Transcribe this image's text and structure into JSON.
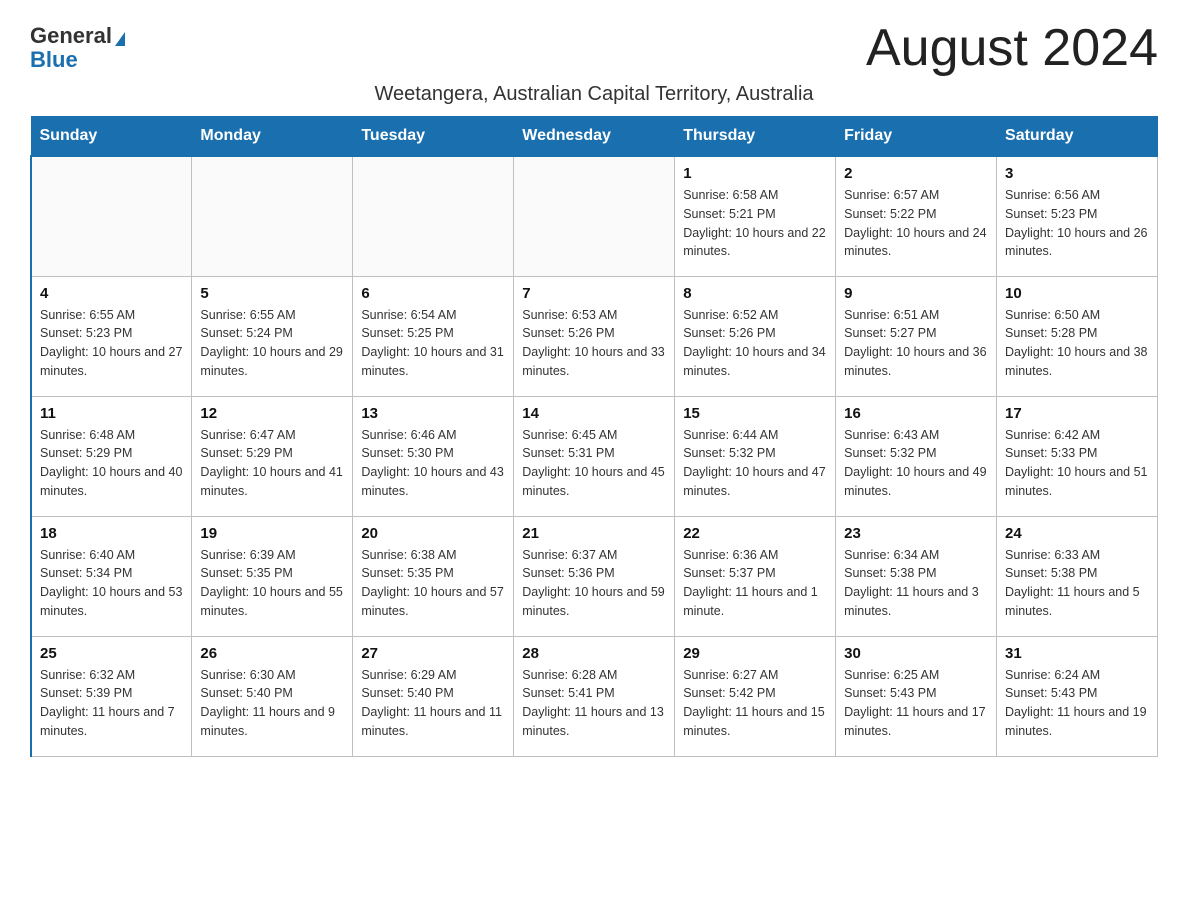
{
  "header": {
    "logo_general": "General",
    "logo_blue": "Blue",
    "month_title": "August 2024",
    "location": "Weetangera, Australian Capital Territory, Australia"
  },
  "columns": [
    "Sunday",
    "Monday",
    "Tuesday",
    "Wednesday",
    "Thursday",
    "Friday",
    "Saturday"
  ],
  "weeks": [
    [
      {
        "day": "",
        "sunrise": "",
        "sunset": "",
        "daylight": ""
      },
      {
        "day": "",
        "sunrise": "",
        "sunset": "",
        "daylight": ""
      },
      {
        "day": "",
        "sunrise": "",
        "sunset": "",
        "daylight": ""
      },
      {
        "day": "",
        "sunrise": "",
        "sunset": "",
        "daylight": ""
      },
      {
        "day": "1",
        "sunrise": "Sunrise: 6:58 AM",
        "sunset": "Sunset: 5:21 PM",
        "daylight": "Daylight: 10 hours and 22 minutes."
      },
      {
        "day": "2",
        "sunrise": "Sunrise: 6:57 AM",
        "sunset": "Sunset: 5:22 PM",
        "daylight": "Daylight: 10 hours and 24 minutes."
      },
      {
        "day": "3",
        "sunrise": "Sunrise: 6:56 AM",
        "sunset": "Sunset: 5:23 PM",
        "daylight": "Daylight: 10 hours and 26 minutes."
      }
    ],
    [
      {
        "day": "4",
        "sunrise": "Sunrise: 6:55 AM",
        "sunset": "Sunset: 5:23 PM",
        "daylight": "Daylight: 10 hours and 27 minutes."
      },
      {
        "day": "5",
        "sunrise": "Sunrise: 6:55 AM",
        "sunset": "Sunset: 5:24 PM",
        "daylight": "Daylight: 10 hours and 29 minutes."
      },
      {
        "day": "6",
        "sunrise": "Sunrise: 6:54 AM",
        "sunset": "Sunset: 5:25 PM",
        "daylight": "Daylight: 10 hours and 31 minutes."
      },
      {
        "day": "7",
        "sunrise": "Sunrise: 6:53 AM",
        "sunset": "Sunset: 5:26 PM",
        "daylight": "Daylight: 10 hours and 33 minutes."
      },
      {
        "day": "8",
        "sunrise": "Sunrise: 6:52 AM",
        "sunset": "Sunset: 5:26 PM",
        "daylight": "Daylight: 10 hours and 34 minutes."
      },
      {
        "day": "9",
        "sunrise": "Sunrise: 6:51 AM",
        "sunset": "Sunset: 5:27 PM",
        "daylight": "Daylight: 10 hours and 36 minutes."
      },
      {
        "day": "10",
        "sunrise": "Sunrise: 6:50 AM",
        "sunset": "Sunset: 5:28 PM",
        "daylight": "Daylight: 10 hours and 38 minutes."
      }
    ],
    [
      {
        "day": "11",
        "sunrise": "Sunrise: 6:48 AM",
        "sunset": "Sunset: 5:29 PM",
        "daylight": "Daylight: 10 hours and 40 minutes."
      },
      {
        "day": "12",
        "sunrise": "Sunrise: 6:47 AM",
        "sunset": "Sunset: 5:29 PM",
        "daylight": "Daylight: 10 hours and 41 minutes."
      },
      {
        "day": "13",
        "sunrise": "Sunrise: 6:46 AM",
        "sunset": "Sunset: 5:30 PM",
        "daylight": "Daylight: 10 hours and 43 minutes."
      },
      {
        "day": "14",
        "sunrise": "Sunrise: 6:45 AM",
        "sunset": "Sunset: 5:31 PM",
        "daylight": "Daylight: 10 hours and 45 minutes."
      },
      {
        "day": "15",
        "sunrise": "Sunrise: 6:44 AM",
        "sunset": "Sunset: 5:32 PM",
        "daylight": "Daylight: 10 hours and 47 minutes."
      },
      {
        "day": "16",
        "sunrise": "Sunrise: 6:43 AM",
        "sunset": "Sunset: 5:32 PM",
        "daylight": "Daylight: 10 hours and 49 minutes."
      },
      {
        "day": "17",
        "sunrise": "Sunrise: 6:42 AM",
        "sunset": "Sunset: 5:33 PM",
        "daylight": "Daylight: 10 hours and 51 minutes."
      }
    ],
    [
      {
        "day": "18",
        "sunrise": "Sunrise: 6:40 AM",
        "sunset": "Sunset: 5:34 PM",
        "daylight": "Daylight: 10 hours and 53 minutes."
      },
      {
        "day": "19",
        "sunrise": "Sunrise: 6:39 AM",
        "sunset": "Sunset: 5:35 PM",
        "daylight": "Daylight: 10 hours and 55 minutes."
      },
      {
        "day": "20",
        "sunrise": "Sunrise: 6:38 AM",
        "sunset": "Sunset: 5:35 PM",
        "daylight": "Daylight: 10 hours and 57 minutes."
      },
      {
        "day": "21",
        "sunrise": "Sunrise: 6:37 AM",
        "sunset": "Sunset: 5:36 PM",
        "daylight": "Daylight: 10 hours and 59 minutes."
      },
      {
        "day": "22",
        "sunrise": "Sunrise: 6:36 AM",
        "sunset": "Sunset: 5:37 PM",
        "daylight": "Daylight: 11 hours and 1 minute."
      },
      {
        "day": "23",
        "sunrise": "Sunrise: 6:34 AM",
        "sunset": "Sunset: 5:38 PM",
        "daylight": "Daylight: 11 hours and 3 minutes."
      },
      {
        "day": "24",
        "sunrise": "Sunrise: 6:33 AM",
        "sunset": "Sunset: 5:38 PM",
        "daylight": "Daylight: 11 hours and 5 minutes."
      }
    ],
    [
      {
        "day": "25",
        "sunrise": "Sunrise: 6:32 AM",
        "sunset": "Sunset: 5:39 PM",
        "daylight": "Daylight: 11 hours and 7 minutes."
      },
      {
        "day": "26",
        "sunrise": "Sunrise: 6:30 AM",
        "sunset": "Sunset: 5:40 PM",
        "daylight": "Daylight: 11 hours and 9 minutes."
      },
      {
        "day": "27",
        "sunrise": "Sunrise: 6:29 AM",
        "sunset": "Sunset: 5:40 PM",
        "daylight": "Daylight: 11 hours and 11 minutes."
      },
      {
        "day": "28",
        "sunrise": "Sunrise: 6:28 AM",
        "sunset": "Sunset: 5:41 PM",
        "daylight": "Daylight: 11 hours and 13 minutes."
      },
      {
        "day": "29",
        "sunrise": "Sunrise: 6:27 AM",
        "sunset": "Sunset: 5:42 PM",
        "daylight": "Daylight: 11 hours and 15 minutes."
      },
      {
        "day": "30",
        "sunrise": "Sunrise: 6:25 AM",
        "sunset": "Sunset: 5:43 PM",
        "daylight": "Daylight: 11 hours and 17 minutes."
      },
      {
        "day": "31",
        "sunrise": "Sunrise: 6:24 AM",
        "sunset": "Sunset: 5:43 PM",
        "daylight": "Daylight: 11 hours and 19 minutes."
      }
    ]
  ]
}
